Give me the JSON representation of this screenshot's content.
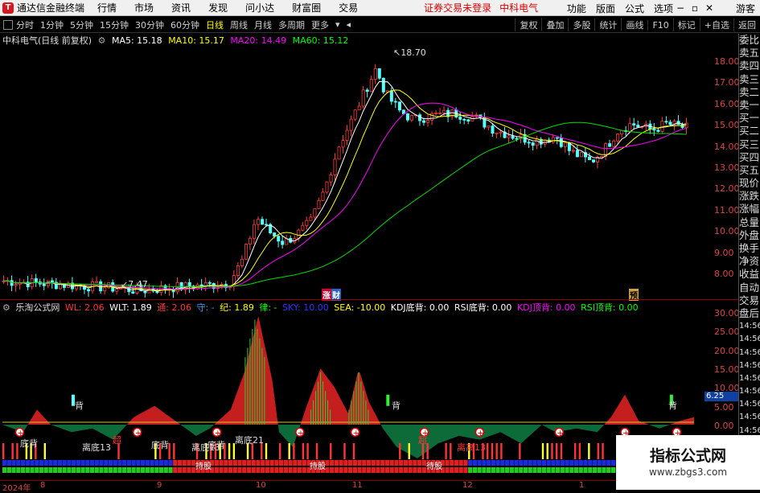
{
  "menubar": {
    "app_title": "通达信金融终端",
    "items": [
      "行情",
      "市场",
      "资讯",
      "发现",
      "问小达",
      "财富圈",
      "交易"
    ],
    "notice": "证券交易未登录",
    "stock": "中科电气",
    "right_items": [
      "功能",
      "版面",
      "公式",
      "选项"
    ],
    "user": "游客"
  },
  "toolbar": {
    "periods": [
      "分时",
      "1分钟",
      "5分钟",
      "15分钟",
      "30分钟",
      "60分钟",
      "日线",
      "周线",
      "月线",
      "多周期",
      "更多"
    ],
    "active_period": "日线",
    "right_buttons": [
      "复权",
      "叠加",
      "多股",
      "统计",
      "画线",
      "F10",
      "标记",
      "+自选",
      "返回"
    ]
  },
  "main_chart": {
    "title": "中科电气(日线 前复权)",
    "ma": [
      {
        "label": "MA5: 15.18",
        "color": "#ffffff"
      },
      {
        "label": "MA10: 15.17",
        "color": "#ffff00"
      },
      {
        "label": "MA20: 14.49",
        "color": "#ff00ff"
      },
      {
        "label": "MA60: 15.12",
        "color": "#00ff00"
      }
    ],
    "high_label": "18.70",
    "low_label": "7.47",
    "y_ticks": [
      "18.00",
      "17.00",
      "16.00",
      "15.00",
      "14.00",
      "13.00",
      "12.00",
      "11.00",
      "10.00",
      "9.00",
      "8.00"
    ],
    "tags": {
      "zhang": "涨",
      "cai": "财",
      "yu": "预"
    }
  },
  "indicator": {
    "name": "乐淘公式网",
    "params": [
      {
        "label": "WL: 2.06",
        "color": "#ff3333"
      },
      {
        "label": "WLT: 1.89",
        "color": "#ffffff"
      },
      {
        "label": "通: 2.06",
        "color": "#ff3333"
      },
      {
        "label": "守: -",
        "color": "#3aa0ff"
      },
      {
        "label": "纪: 1.89",
        "color": "#ffff00"
      },
      {
        "label": "律: -",
        "color": "#00ff00"
      },
      {
        "label": "SKY: 10.00",
        "color": "#3030ff"
      },
      {
        "label": "SEA: -10.00",
        "color": "#ffff00"
      },
      {
        "label": "KDJ底背: 0.00",
        "color": "#ffffff"
      },
      {
        "label": "RSI底背: 0.00",
        "color": "#ffffff"
      },
      {
        "label": "KDJ顶背: 0.00",
        "color": "#ff00ff"
      },
      {
        "label": "RSI顶背: 0.00",
        "color": "#00ff00"
      }
    ],
    "y_ticks": [
      "30.00",
      "25.00",
      "20.00",
      "15.00",
      "10.00",
      "5.00",
      "0.00"
    ],
    "current_value": "6.25",
    "labels": {
      "bei": "背",
      "dibei": "底背",
      "libei": "离底13",
      "libei2": "离底21",
      "ligao": "离高13",
      "chao": "超",
      "chigu": "持股",
      "dai": "待股"
    }
  },
  "sidebar": [
    "委比",
    "卖五",
    "卖四",
    "卖三",
    "卖二",
    "卖一",
    "买一",
    "买二",
    "买三",
    "买四",
    "买五",
    "现价",
    "涨跌",
    "涨幅",
    "总量",
    "外盘",
    "换手",
    "净资",
    "收益",
    "自动",
    "交易",
    "盘后",
    "14:56",
    "14:56",
    "14:56",
    "14:56",
    "14:56",
    "14:56",
    "14:56",
    "14:56",
    "14:56"
  ],
  "date_axis": [
    "2024年",
    "8",
    "9",
    "10",
    "11",
    "12",
    "1"
  ],
  "watermark": {
    "title": "指标公式网",
    "url": "www.zbgs3.com"
  }
}
